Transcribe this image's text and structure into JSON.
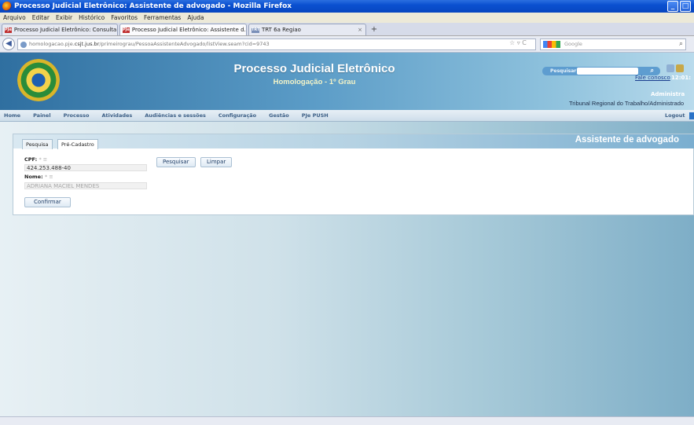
{
  "window": {
    "title": "Processo Judicial Eletrônico: Assistente de advogado - Mozilla Firefox",
    "controls": [
      "_",
      "□"
    ]
  },
  "menu": [
    "Arquivo",
    "Editar",
    "Exibir",
    "Histórico",
    "Favoritos",
    "Ferramentas",
    "Ajuda"
  ],
  "tabs": [
    {
      "label": "Processo Judicial Eletrônico: Consulta pro...",
      "icon": "PJe",
      "active": false
    },
    {
      "label": "Processo Judicial Eletrônico: Assistente d...",
      "icon": "PJe",
      "active": true
    },
    {
      "label": "TRT 6a Regiao",
      "icon": "TRT",
      "active": false
    }
  ],
  "nav": {
    "url_prefix": "homologacao.pje.",
    "url_host": "csjt.jus.br",
    "url_path": "/primeirograu/PessoaAssistenteAdvogado/listView.seam?cid=9743",
    "search_placeholder": "Google",
    "back_symbol": "◀"
  },
  "header": {
    "system_title": "Processo Judicial Eletrônico",
    "system_subtitle": "Homologação - 1º Grau",
    "search_label": "Pesquisar",
    "fale_conosco": "Fale conosco",
    "clock": "12:01:",
    "user": "Administra",
    "court": "Tribunal Regional do Trabalho/Administrado"
  },
  "main_nav": {
    "items": [
      "Home",
      "Painel",
      "Processo",
      "Atividades",
      "Audiências e sessões",
      "Configuração",
      "Gestão",
      "PJe PUSH"
    ],
    "logout": "Logout"
  },
  "panel": {
    "title": "Assistente de advogado",
    "tabs": [
      "Pesquisa",
      "Pré-Cadastro"
    ],
    "active_tab": "Pré-Cadastro",
    "cpf_label": "CPF:",
    "cpf_value": "424.253.488-40",
    "nome_label": "Nome:",
    "nome_value": "ADRIANA MACIEL MENDES",
    "required_marker": "* ≡",
    "btn_pesquisar": "Pesquisar",
    "btn_limpar": "Limpar",
    "btn_confirmar": "Confirmar"
  },
  "colors": {
    "titlebar": "#0a50d0",
    "header_dark": "#2f6fa0",
    "panel_title": "#ffffff",
    "nav_text": "#3d5f86"
  }
}
